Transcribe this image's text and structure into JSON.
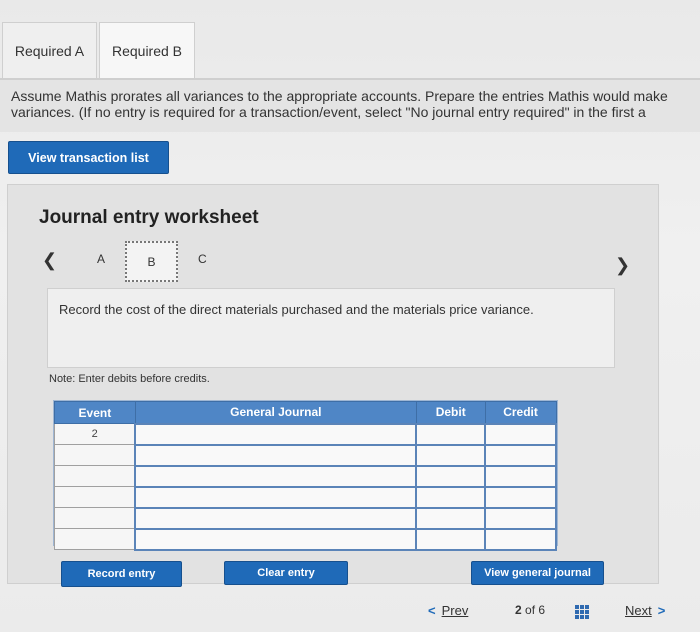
{
  "tabs": [
    {
      "label": "Required A"
    },
    {
      "label": "Required B"
    }
  ],
  "instructions": {
    "line1": "Assume Mathis prorates all variances to the appropriate accounts. Prepare the entries Mathis would make",
    "line2": "variances. (If no entry is required for a transaction/event, select \"No journal entry required\" in the first a"
  },
  "buttons": {
    "view_transaction_list": "View transaction list",
    "record_entry": "Record entry",
    "clear_entry": "Clear entry",
    "view_general_journal": "View general journal"
  },
  "worksheet": {
    "title": "Journal entry worksheet",
    "steps": [
      "A",
      "B",
      "C"
    ],
    "active_step": "B",
    "description": "Record the cost of the direct materials purchased and the materials price variance.",
    "note": "Note: Enter debits before credits."
  },
  "journal": {
    "headers": [
      "Event",
      "General Journal",
      "Debit",
      "Credit"
    ],
    "rows": [
      {
        "event": "2",
        "account": "",
        "debit": "",
        "credit": ""
      },
      {
        "event": "",
        "account": "",
        "debit": "",
        "credit": ""
      },
      {
        "event": "",
        "account": "",
        "debit": "",
        "credit": ""
      },
      {
        "event": "",
        "account": "",
        "debit": "",
        "credit": ""
      },
      {
        "event": "",
        "account": "",
        "debit": "",
        "credit": ""
      },
      {
        "event": "",
        "account": "",
        "debit": "",
        "credit": ""
      }
    ]
  },
  "pagination": {
    "prev_label": "Prev",
    "current": "2",
    "of_label": "of",
    "total": "6",
    "next_label": "Next"
  },
  "colors": {
    "primary_blue": "#1f6ab8",
    "header_blue": "#4f86c6"
  },
  "icons": {
    "prev": "chevron-left-icon",
    "next": "chevron-right-icon",
    "grid": "grid-icon"
  }
}
